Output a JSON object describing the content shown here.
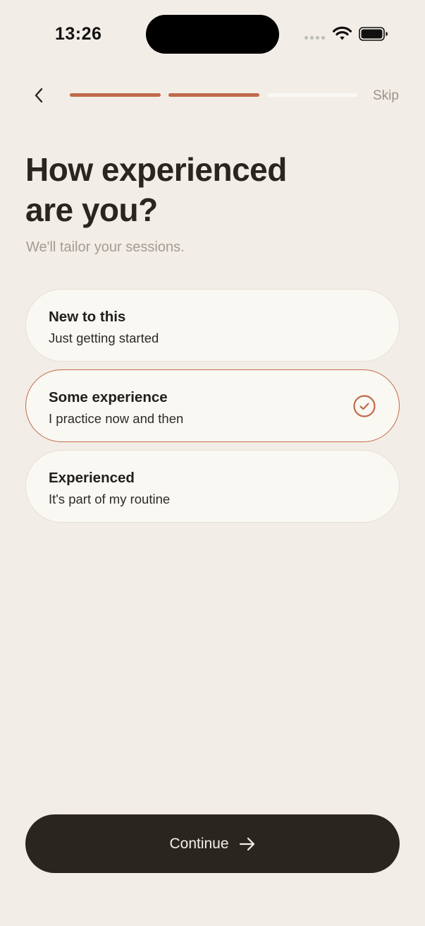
{
  "status_bar": {
    "time": "13:26"
  },
  "nav": {
    "progress": {
      "total_steps": 3,
      "completed_steps": 2
    },
    "skip_label": "Skip"
  },
  "header": {
    "title_line1": "How experienced",
    "title_line2": "are you?",
    "subtitle": "We'll tailor your sessions."
  },
  "options": [
    {
      "label": "New to this",
      "description": "Just getting started",
      "selected": false
    },
    {
      "label": "Some experience",
      "description": "I practice now and then",
      "selected": true
    },
    {
      "label": "Experienced",
      "description": "It's part of my routine",
      "selected": false
    }
  ],
  "footer": {
    "continue_label": "Continue"
  },
  "colors": {
    "background": "#F2EDE6",
    "accent": "#C06A4A",
    "card": "#FAF8F3",
    "primary_button": "#2B2520",
    "muted_text": "#A39C94"
  }
}
